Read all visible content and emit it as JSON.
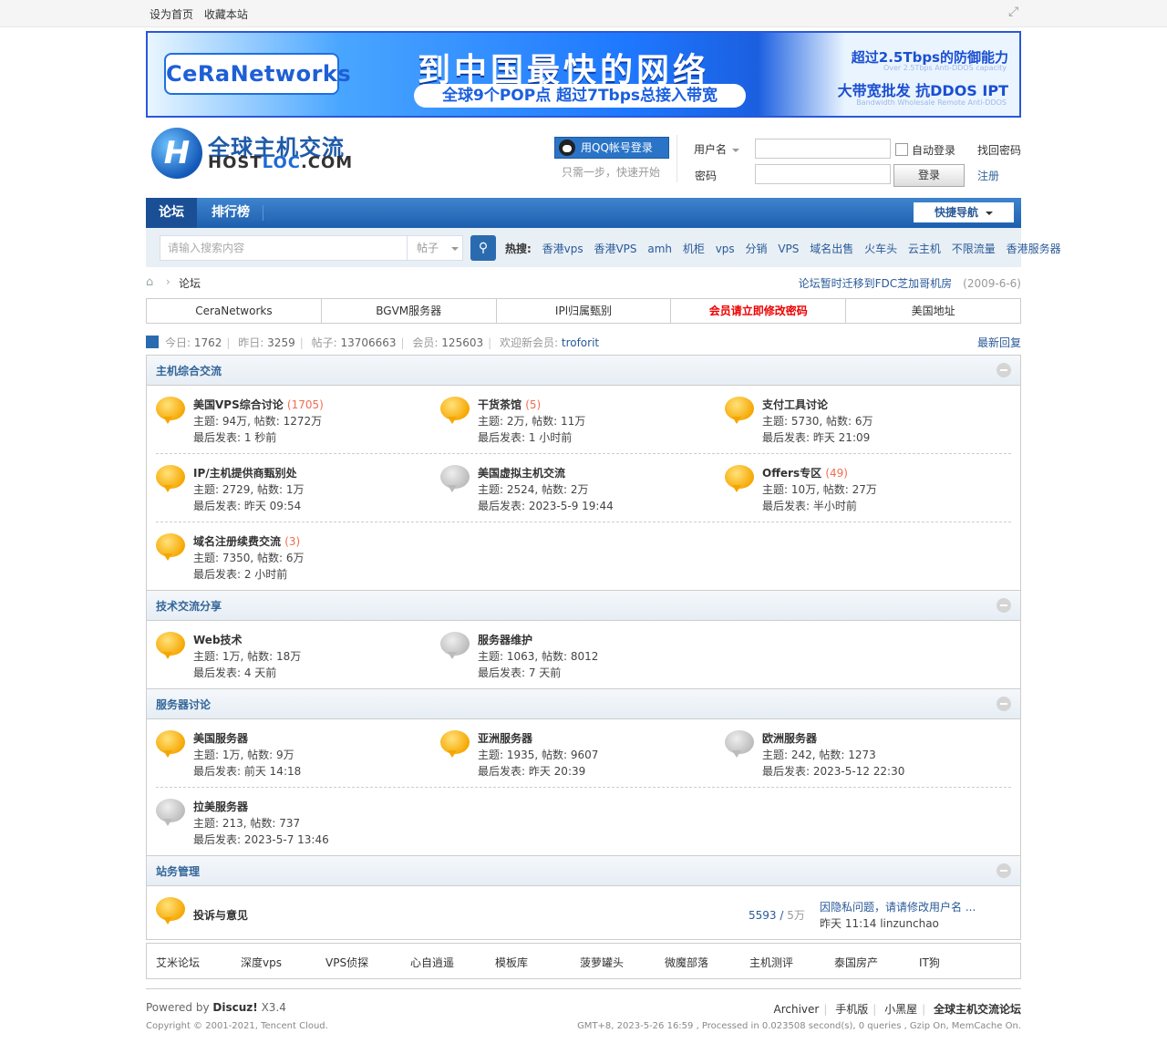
{
  "topbar": {
    "set_home": "设为首页",
    "bookmark": "收藏本站"
  },
  "banner": {
    "logo": "CeRaNetworks",
    "headline": "到中国最快的网络",
    "sub": "全球9个POP点  超过7Tbps总接入带宽",
    "right1": "超过2.5Tbps的防御能力",
    "right1_sub": "Over 2.5Tbps Anti-DDOS capacity",
    "right2": "大带宽批发  抗DDOS IPT",
    "right2_sub": "Bandwidth Wholesale  Remote Anti-DDOS"
  },
  "site": {
    "logo_cn": "全球主机交流",
    "logo_en_a": "HOST",
    "logo_en_b": "LOC",
    "logo_en_c": ".COM"
  },
  "login": {
    "qq_button": "用QQ帐号登录",
    "qq_hint": "只需一步，快速开始",
    "username_label": "用户名",
    "password_label": "密码",
    "auto_login": "自动登录",
    "login_button": "登录",
    "find_password": "找回密码",
    "register": "注册"
  },
  "nav": {
    "items": [
      "论坛",
      "排行榜"
    ],
    "quick_nav": "快捷导航"
  },
  "search": {
    "placeholder": "请输入搜索内容",
    "type": "帖子",
    "hot_label": "热搜:",
    "hot": [
      "香港vps",
      "香港VPS",
      "amh",
      "机柜",
      "vps",
      "分销",
      "VPS",
      "域名出售",
      "火车头",
      "云主机",
      "不限流量",
      "香港服务器"
    ]
  },
  "breadcrumb": {
    "current": "论坛",
    "notice": "论坛暂时迁移到FDC芝加哥机房",
    "notice_date": "(2009-6-6)"
  },
  "tabs": [
    "CeraNetworks",
    "BGVM服务器",
    "IPl归属甄别",
    "会员请立即修改密码",
    "美国地址"
  ],
  "stats": {
    "today_label": "今日:",
    "today": "1762",
    "yesterday_label": "昨日:",
    "yesterday": "3259",
    "posts_label": "帖子:",
    "posts": "13706663",
    "members_label": "会员:",
    "members": "125603",
    "newest_label": "欢迎新会员:",
    "newest": "troforit",
    "latest_replies": "最新回复"
  },
  "categories": [
    {
      "title": "主机综合交流",
      "rows": [
        [
          {
            "name": "美国VPS综合讨论",
            "today": "(1705)",
            "stats": "主题: 94万, 帖数: 1272万",
            "last": "最后发表: 1 秒前",
            "icon": "new"
          },
          {
            "name": "干货茶馆",
            "today": "(5)",
            "stats": "主题: 2万, 帖数: 11万",
            "last": "最后发表: 1 小时前",
            "icon": "new"
          },
          {
            "name": "支付工具讨论",
            "today": "",
            "stats": "主题: 5730, 帖数: 6万",
            "last": "最后发表: 昨天 21:09",
            "icon": "new"
          }
        ],
        [
          {
            "name": "IP/主机提供商甄别处",
            "today": "",
            "stats": "主题: 2729, 帖数: 1万",
            "last": "最后发表: 昨天 09:54",
            "icon": "new"
          },
          {
            "name": "美国虚拟主机交流",
            "today": "",
            "stats": "主题: 2524, 帖数: 2万",
            "last": "最后发表: 2023-5-9 19:44",
            "icon": "old"
          },
          {
            "name": "Offers专区",
            "today": "(49)",
            "stats": "主题: 10万, 帖数: 27万",
            "last": "最后发表: 半小时前",
            "icon": "new"
          }
        ],
        [
          {
            "name": "域名注册续费交流",
            "today": "(3)",
            "stats": "主题: 7350, 帖数: 6万",
            "last": "最后发表: 2 小时前",
            "icon": "new"
          }
        ]
      ]
    },
    {
      "title": "技术交流分享",
      "rows": [
        [
          {
            "name": "Web技术",
            "today": "",
            "stats": "主题: 1万, 帖数: 18万",
            "last": "最后发表: 4 天前",
            "icon": "new"
          },
          {
            "name": "服务器维护",
            "today": "",
            "stats": "主题: 1063, 帖数: 8012",
            "last": "最后发表: 7 天前",
            "icon": "old"
          }
        ]
      ]
    },
    {
      "title": "服务器讨论",
      "rows": [
        [
          {
            "name": "美国服务器",
            "today": "",
            "stats": "主题: 1万, 帖数: 9万",
            "last": "最后发表: 前天 14:18",
            "icon": "new"
          },
          {
            "name": "亚洲服务器",
            "today": "",
            "stats": "主题: 1935, 帖数: 9607",
            "last": "最后发表: 昨天 20:39",
            "icon": "new"
          },
          {
            "name": "欧洲服务器",
            "today": "",
            "stats": "主题: 242, 帖数: 1273",
            "last": "最后发表: 2023-5-12 22:30",
            "icon": "old"
          }
        ],
        [
          {
            "name": "拉美服务器",
            "today": "",
            "stats": "主题: 213, 帖数: 737",
            "last": "最后发表: 2023-5-7 13:46",
            "icon": "old"
          }
        ]
      ]
    }
  ],
  "site_admin": {
    "title": "站务管理",
    "forum": "投诉与意见",
    "threads": "5593",
    "posts": "5万",
    "last_title": "因隐私问题，请请修改用户名 ...",
    "last_meta": "昨天 11:14 linzunchao"
  },
  "friend_links": [
    "艾米论坛",
    "深度vps",
    "VPS侦探",
    "心自逍遥",
    "模板库",
    "菠萝罐头",
    "微魔部落",
    "主机测评",
    "泰国房产",
    "IT狗"
  ],
  "footer": {
    "powered_prefix": "Powered by",
    "powered_name": "Discuz!",
    "powered_ver": "X3.4",
    "copyright": "Copyright © 2001-2021, Tencent Cloud.",
    "links": [
      "Archiver",
      "手机版",
      "小黑屋"
    ],
    "site_name": "全球主机交流论坛",
    "gmt": "GMT+8, 2023-5-26 16:59 , Processed in 0.023508 second(s), 0 queries , Gzip On, MemCache On."
  }
}
